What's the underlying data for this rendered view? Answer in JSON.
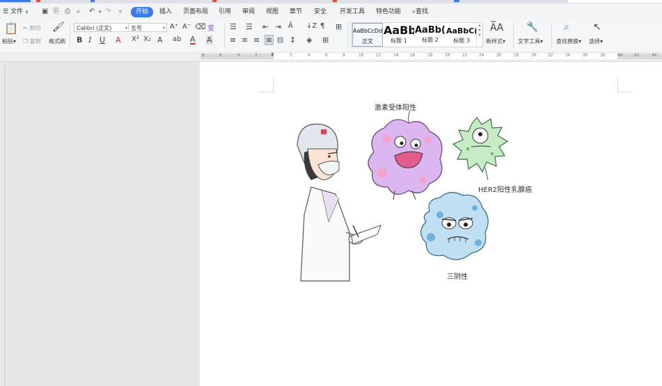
{
  "menu": {
    "file": "文件",
    "tabs": [
      "开始",
      "插入",
      "页面布局",
      "引用",
      "审阅",
      "视图",
      "章节",
      "安全",
      "开发工具",
      "特色功能"
    ],
    "active_tab": "开始",
    "search": "查找"
  },
  "ribbon": {
    "paste": "粘贴",
    "cut": "剪切",
    "copy": "复制",
    "format_painter": "格式刷",
    "font_name": "Calibri (正文)",
    "font_size": "五号",
    "styles": [
      {
        "sample": "AaBbCcDd",
        "caption": "正文"
      },
      {
        "sample": "AaBb",
        "caption": "标题 1"
      },
      {
        "sample": "AaBb(",
        "caption": "标题 2"
      },
      {
        "sample": "AaBbC(",
        "caption": "标题 3"
      }
    ],
    "new_style": "新样式",
    "text_tools": "文字工具",
    "find_replace": "查找替换",
    "select": "选择"
  },
  "ruler_ticks": [
    "8",
    "6",
    "4",
    "2",
    "2",
    "4",
    "6",
    "8",
    "10",
    "12",
    "14",
    "16",
    "18",
    "20",
    "22",
    "24",
    "26",
    "28",
    "30",
    "32",
    "34",
    "36",
    "38",
    "40",
    "42",
    "44"
  ],
  "document": {
    "caption_hormone": "激素受体阳性",
    "caption_her2": "HER2阳性乳腺癌",
    "caption_triple": "三阴性"
  },
  "colors": {
    "active_tab": "#3d7ce8",
    "purple_cell": "#dcb6ee",
    "green_cell": "#c6ecc6",
    "blue_cell": "#bfe0f2"
  }
}
